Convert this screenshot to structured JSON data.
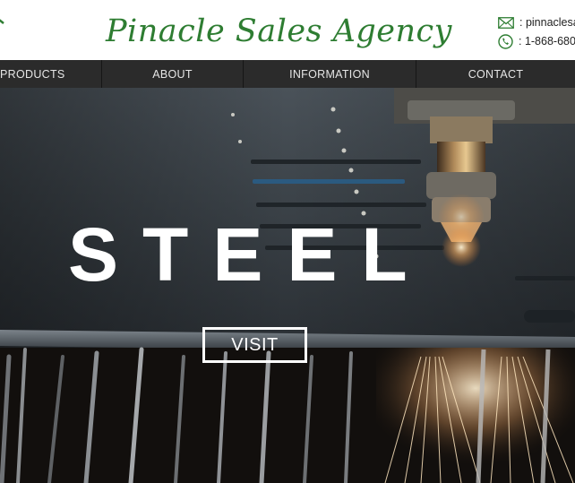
{
  "header": {
    "brand_name": "Pinacle Sales Agency",
    "email": ": pinnaclesa",
    "phone": ": 1-868-680-"
  },
  "icons": {
    "logo": "leaf-corner-icon",
    "email": "envelope-icon",
    "phone": "phone-icon"
  },
  "nav": {
    "items": [
      {
        "label": "PRODUCTS"
      },
      {
        "label": "ABOUT"
      },
      {
        "label": "INFORMATION"
      },
      {
        "label": "CONTACT"
      }
    ]
  },
  "hero": {
    "title": "STEEL",
    "button_label": "VISIT"
  },
  "colors": {
    "brand_green": "#2e7d32",
    "nav_bg": "#2b2b2b",
    "nav_text": "#e6e6e6"
  }
}
